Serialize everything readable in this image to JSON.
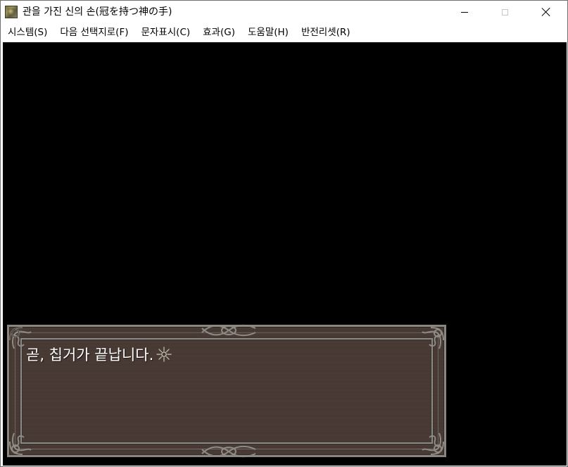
{
  "window": {
    "title": "관을 가진 신의 손(冠を持つ神の手)",
    "icon": "app-icon",
    "controls": {
      "minimize_icon": "minimize-icon",
      "maximize_icon": "maximize-icon",
      "close_icon": "close-icon"
    }
  },
  "menu": {
    "items": [
      {
        "label": "시스템(S)"
      },
      {
        "label": "다음 선택지로(F)"
      },
      {
        "label": "문자표시(C)"
      },
      {
        "label": "효과(G)"
      },
      {
        "label": "도움말(H)"
      },
      {
        "label": "반전리셋(R)"
      }
    ]
  },
  "game": {
    "background_color": "#000000",
    "message": {
      "text": "곧, 칩거가 끝납니다.",
      "continue_icon": "sparkle-cursor-icon"
    },
    "colors": {
      "message_panel": "#4a3a33",
      "frame": "#8a857e",
      "text": "#ffffff"
    }
  }
}
